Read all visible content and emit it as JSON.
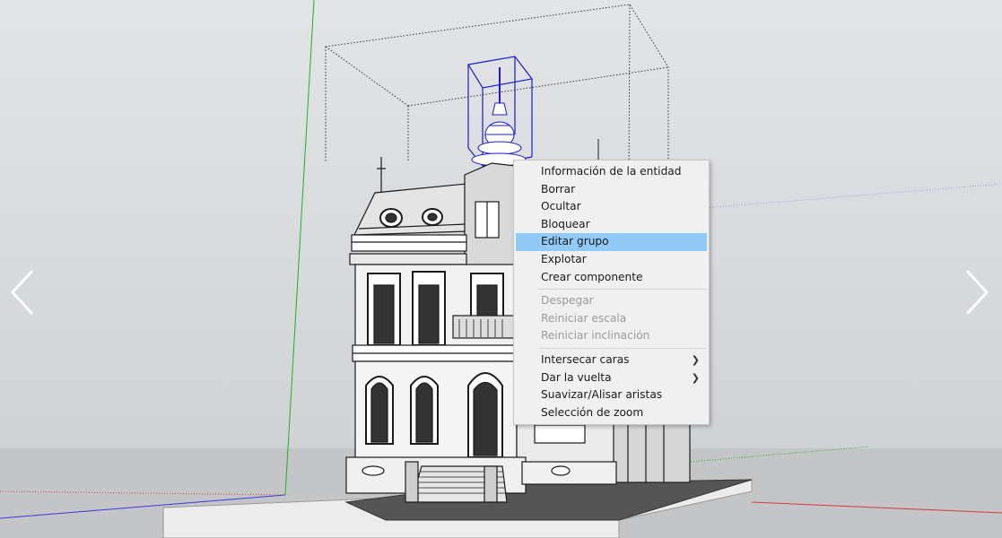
{
  "context_menu": {
    "groups": [
      [
        {
          "label": "Información de la entidad",
          "state": "normal"
        },
        {
          "label": "Borrar",
          "state": "normal"
        },
        {
          "label": "Ocultar",
          "state": "normal"
        },
        {
          "label": "Bloquear",
          "state": "normal"
        },
        {
          "label": "Editar grupo",
          "state": "highlighted"
        },
        {
          "label": "Explotar",
          "state": "normal"
        },
        {
          "label": "Crear componente",
          "state": "normal"
        }
      ],
      [
        {
          "label": "Despegar",
          "state": "disabled"
        },
        {
          "label": "Reiniciar escala",
          "state": "disabled"
        },
        {
          "label": "Reiniciar inclinación",
          "state": "disabled"
        }
      ],
      [
        {
          "label": "Intersecar caras",
          "state": "normal",
          "submenu": true
        },
        {
          "label": "Dar la vuelta",
          "state": "normal",
          "submenu": true
        },
        {
          "label": "Suavizar/Alisar aristas",
          "state": "normal"
        },
        {
          "label": "Selección de zoom",
          "state": "normal"
        }
      ]
    ],
    "highlight_color": "#91c9f7",
    "disabled_color": "#9a9a9a",
    "submenu_icon": "chevron-right-icon"
  },
  "viewport": {
    "sky_color": "#d9dcdf",
    "ground_color": "#c5c6c8",
    "selection_color": "#1c1ccf",
    "axis_colors": {
      "green": "#22b022",
      "red": "#d23b3b",
      "blue": "#3a3ad6"
    }
  },
  "navigation": {
    "prev_icon": "chevron-left-icon",
    "next_icon": "chevron-right-icon"
  }
}
